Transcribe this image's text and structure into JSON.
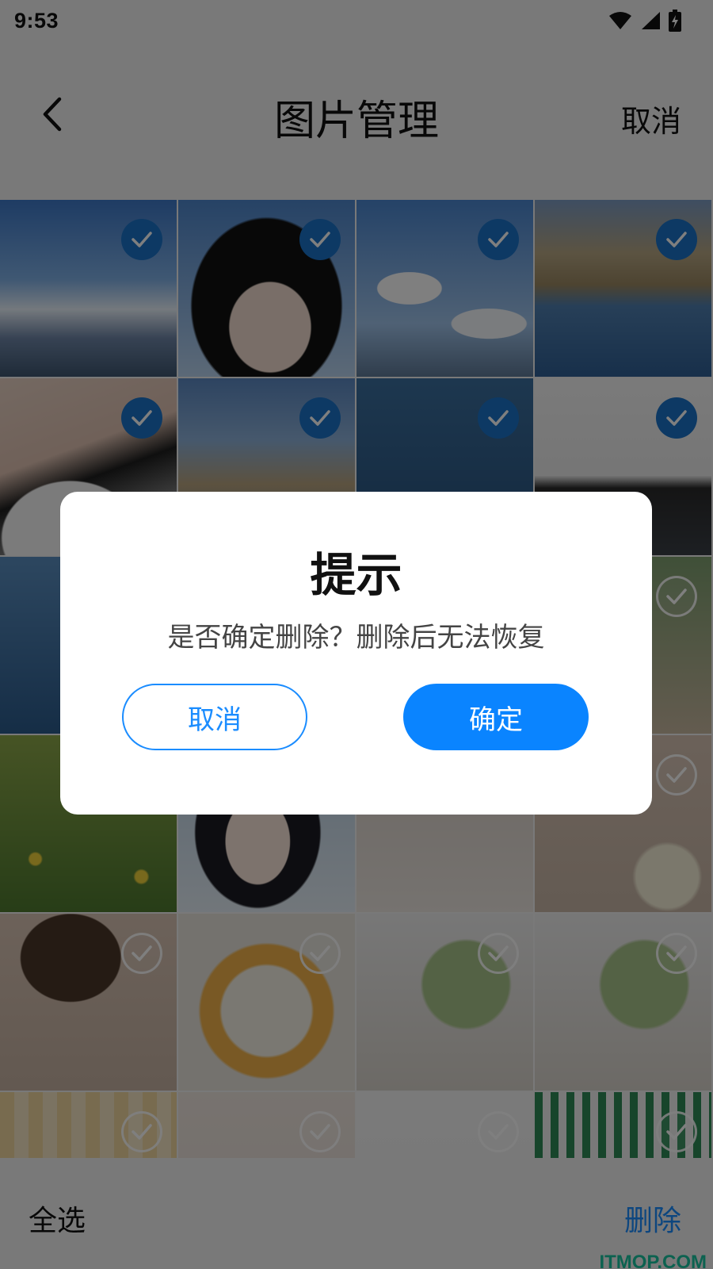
{
  "status_bar": {
    "time": "9:53",
    "icons": [
      "wifi-icon",
      "signal-icon",
      "battery-charging-icon"
    ]
  },
  "header": {
    "back_icon": "chevron-left-icon",
    "title": "图片管理",
    "cancel_label": "取消"
  },
  "grid": {
    "items": [
      {
        "checked": true,
        "subject": "sky-mountain"
      },
      {
        "checked": true,
        "subject": "girl-portrait"
      },
      {
        "checked": true,
        "subject": "sky-clouds"
      },
      {
        "checked": true,
        "subject": "lake-girl"
      },
      {
        "checked": true,
        "subject": "girl-white-shirt"
      },
      {
        "checked": true,
        "subject": "mountain-hair"
      },
      {
        "checked": true,
        "subject": "lake-branch"
      },
      {
        "checked": true,
        "subject": "girl-waist"
      },
      {
        "checked": false,
        "subject": "girl-arm-lake"
      },
      {
        "checked": false,
        "subject": "lake"
      },
      {
        "checked": false,
        "subject": "lake"
      },
      {
        "checked": false,
        "subject": "girl-flowers"
      },
      {
        "checked": false,
        "subject": "flower-field"
      },
      {
        "checked": false,
        "subject": "anime-girl"
      },
      {
        "checked": false,
        "subject": "flowers-dress"
      },
      {
        "checked": false,
        "subject": "lily-shoulder"
      },
      {
        "checked": false,
        "subject": "curly-hair-girl"
      },
      {
        "checked": false,
        "subject": "noodle-soup"
      },
      {
        "checked": false,
        "subject": "green-bun"
      },
      {
        "checked": false,
        "subject": "green-bun"
      },
      {
        "checked": false,
        "subject": "plaid-text"
      },
      {
        "checked": false,
        "subject": "beige"
      },
      {
        "checked": false,
        "subject": "handwriting"
      },
      {
        "checked": false,
        "subject": "cherry-plaid"
      }
    ]
  },
  "bottom_bar": {
    "select_all_label": "全选",
    "delete_label": "删除"
  },
  "watermark": "ITMOP.COM",
  "dialog": {
    "title": "提示",
    "message": "是否确定删除？删除后无法恢复",
    "cancel_label": "取消",
    "confirm_label": "确定"
  },
  "colors": {
    "accent": "#0a84ff",
    "check_fill": "#1a73c8",
    "watermark": "#19c4a0"
  }
}
